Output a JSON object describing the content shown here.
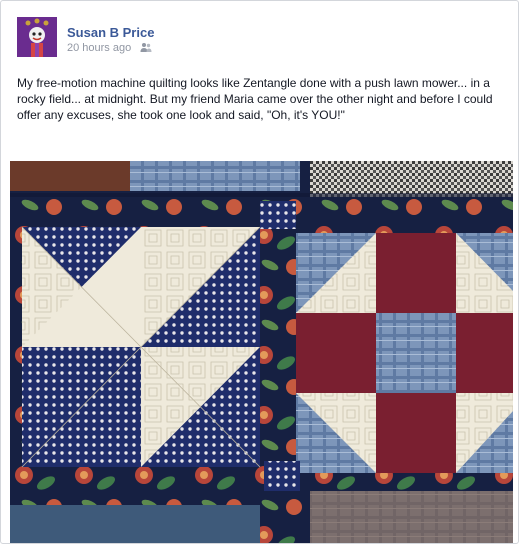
{
  "post": {
    "author": "Susan B Price",
    "timestamp": "20 hours ago",
    "audience_icon": "friends-icon",
    "body": "My free-motion machine quilting looks like Zentangle done with a push lawn mower... in a rocky field... at midnight. But my friend Maria came over the other night and before I could offer any excuses, she took one look and said, \"Oh, it's YOU!\"",
    "photo_subject": "quilt-photo"
  },
  "colors": {
    "author_link": "#3b5998",
    "meta_text": "#9197a3",
    "navy": "#1f2d6b",
    "cream": "#efeadb",
    "burgundy": "#7a1f30",
    "plaid_blue": "#7d96ba"
  }
}
